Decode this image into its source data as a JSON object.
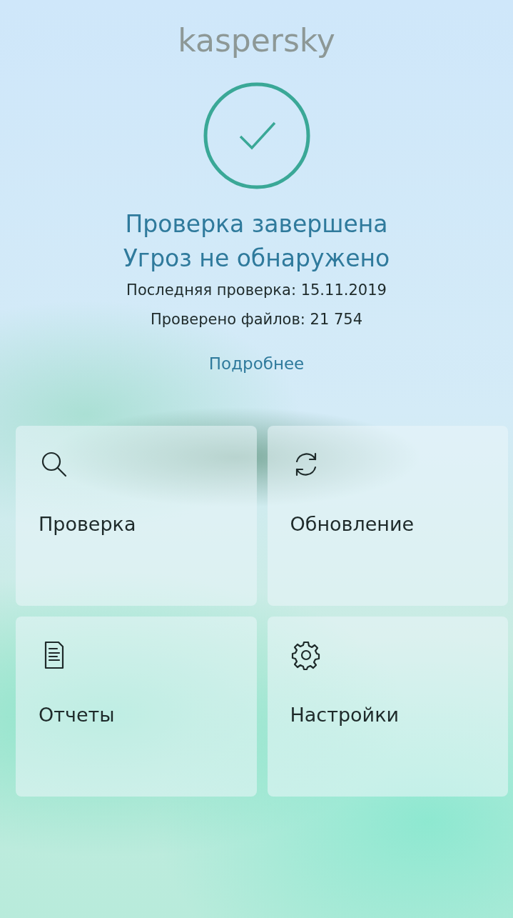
{
  "logo": "kaspersky",
  "status": {
    "title": "Проверка завершена",
    "subtitle": "Угроз не обнаружено",
    "last_scan": "Последняя проверка: 15.11.2019",
    "files_scanned": "Проверено файлов: 21 754",
    "details_link": "Подробнее"
  },
  "tiles": [
    {
      "kind": "search",
      "label": "Проверка"
    },
    {
      "kind": "update",
      "label": "Обновление"
    },
    {
      "kind": "reports",
      "label": "Отчеты"
    },
    {
      "kind": "settings",
      "label": "Настройки"
    }
  ]
}
